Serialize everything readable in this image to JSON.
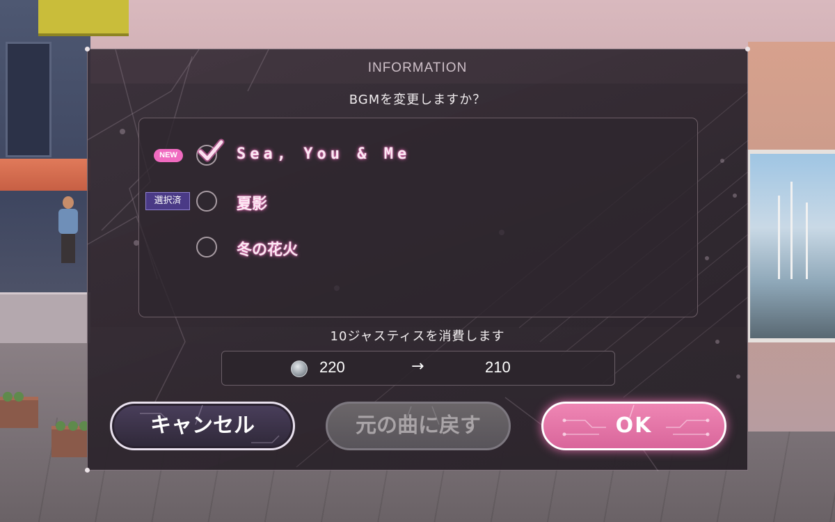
{
  "dialog": {
    "title": "INFORMATION",
    "question": "BGMを変更しますか？"
  },
  "songs": [
    {
      "name": "Sea, You & Me",
      "badge": "NEW",
      "checked": true
    },
    {
      "name": "夏影",
      "badge": "選択済",
      "checked": false
    },
    {
      "name": "冬の花火",
      "badge": "",
      "checked": false
    }
  ],
  "cost": {
    "text": "10ジャスティスを消費します",
    "before": "220",
    "arrow": "→",
    "after": "210",
    "icon": "justice-coin-icon"
  },
  "buttons": {
    "cancel": "キャンセル",
    "revert": "元の曲に戻す",
    "ok": "OK"
  },
  "colors": {
    "accent_pink": "#f06bc0",
    "ok_button": "#e077a9",
    "selected_badge": "#4a3a86",
    "dialog_bg": "#2f2730"
  }
}
